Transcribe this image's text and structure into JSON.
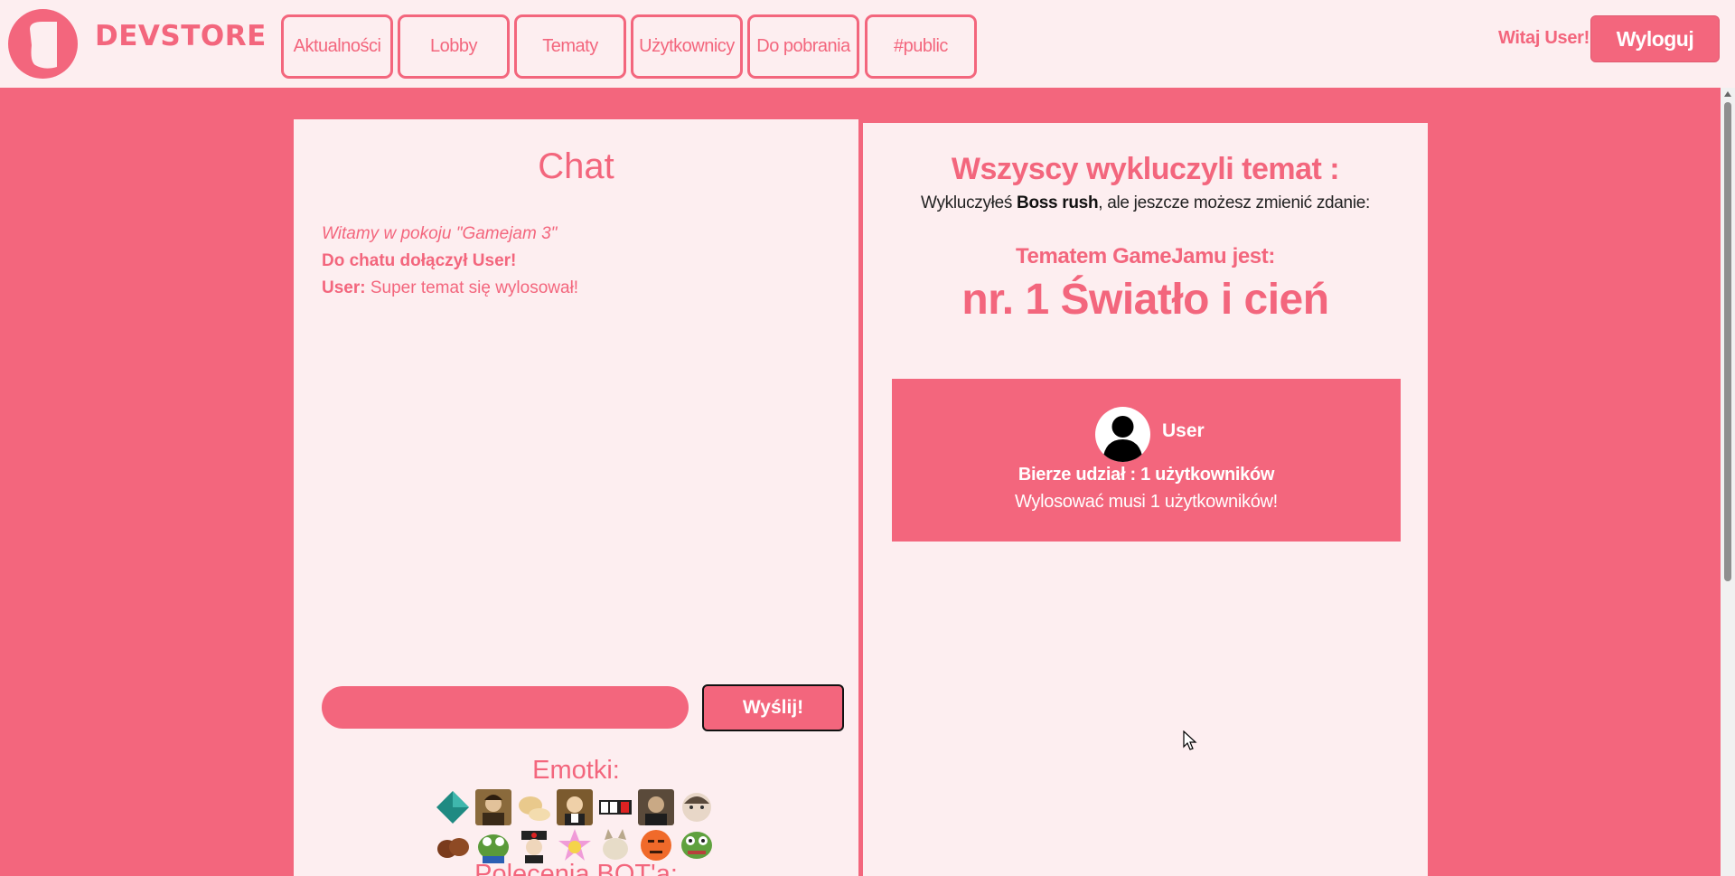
{
  "header": {
    "brand": "DEVSTORE",
    "nav": [
      {
        "label": "Aktualności",
        "name": "nav-aktualnosci"
      },
      {
        "label": "Lobby",
        "name": "nav-lobby"
      },
      {
        "label": "Tematy",
        "name": "nav-tematy"
      },
      {
        "label": "Użytkownicy",
        "name": "nav-uzytkownicy"
      },
      {
        "label": "Do pobrania",
        "name": "nav-do-pobrania"
      },
      {
        "label": "#public",
        "name": "nav-public"
      }
    ],
    "welcome": "Witaj User!",
    "logout_label": "Wyloguj"
  },
  "chat": {
    "title": "Chat",
    "messages": {
      "welcome": "Witamy w pokoju \"Gamejam 3\"",
      "joined": "Do chatu dołączył User!",
      "user_author": "User:",
      "user_text": " Super temat się wylosował!"
    },
    "input_value": "",
    "send_label": "Wyślij!",
    "emotes_title": "Emotki:",
    "bot_title": "Polecenia BOT'a:",
    "emotes": [
      "diamond-emote",
      "portrait-emote-1",
      "bread-emote",
      "portrait-emote-2",
      "counter-emote",
      "portrait-emote-3",
      "face-emote-1",
      "chestnut-emote",
      "pepe-emote-1",
      "pirate-emote",
      "star-emote",
      "cat-emote",
      "angry-emote",
      "pepe-emote-2"
    ]
  },
  "topic": {
    "title": "Wszyscy wykluczyli temat :",
    "desc_prefix": "Wykluczyłeś ",
    "desc_bold": "Boss rush",
    "desc_suffix": ", ale jeszcze możesz zmienić zdanie:",
    "jam_label": "Tematem GameJamu jest:",
    "jam_topic": "nr. 1 Światło i cień",
    "participant_name": "User",
    "participant_count": "Bierze udział : 1 użytkowników",
    "draw_required": "Wylosować musi 1 użytkowników!"
  },
  "colors": {
    "accent": "#f3667d",
    "panel": "#fdeef0"
  }
}
